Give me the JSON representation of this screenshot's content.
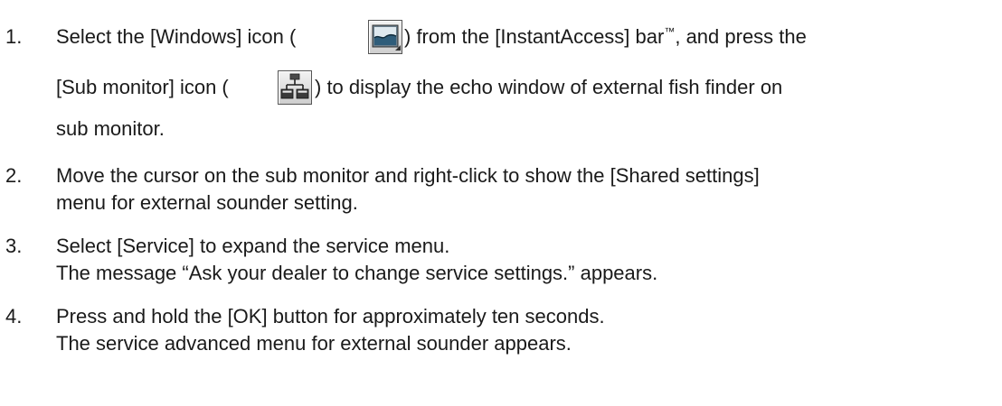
{
  "steps": [
    {
      "number": "1.",
      "line1_a": "Select the [Windows] icon (",
      "line1_b": ") from the [InstantAccess] bar",
      "tm": "™",
      "line1_c": ", and press the",
      "line2_a": "[Sub monitor] icon (",
      "line2_b": ") to display the echo window of external fish finder on",
      "line3": "sub monitor."
    },
    {
      "number": "2.",
      "line1": "Move the cursor on the sub monitor and right-click to show the [Shared settings]",
      "line2": "menu for external sounder setting."
    },
    {
      "number": "3.",
      "line1": "Select [Service] to expand the service menu.",
      "line2": "The message “Ask your dealer to change service settings.” appears."
    },
    {
      "number": "4.",
      "line1": "Press and hold the [OK] button for approximately ten seconds.",
      "line2": "The service advanced menu for external sounder appears."
    }
  ],
  "icons": {
    "windows": "windows-icon",
    "sub_monitor": "sub-monitor-icon"
  }
}
